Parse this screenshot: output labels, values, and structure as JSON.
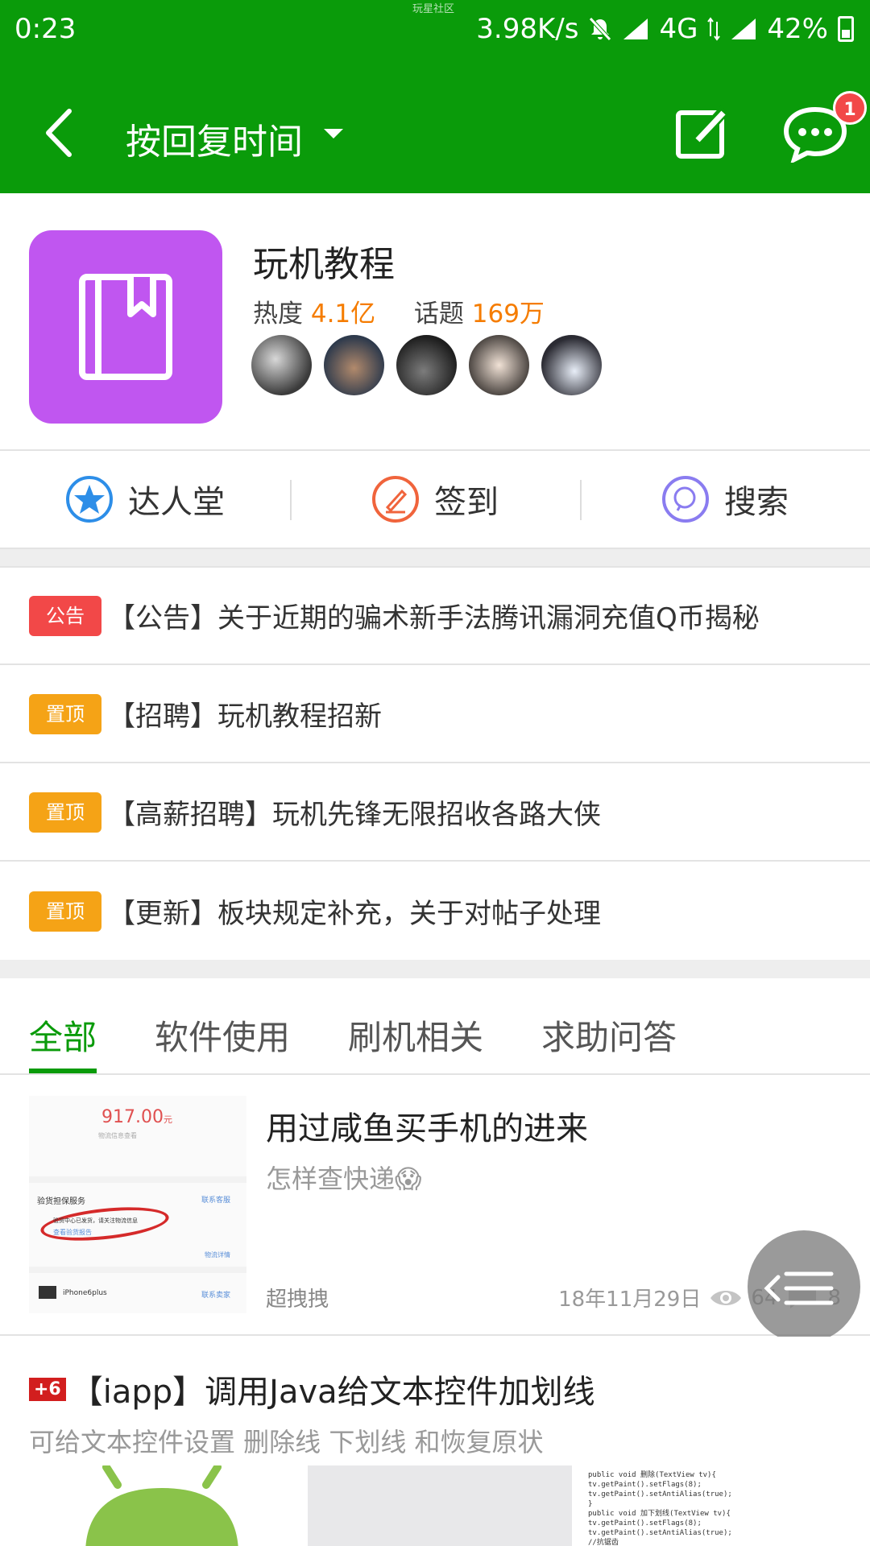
{
  "status_bar": {
    "time": "0:23",
    "watermark": "玩星社区",
    "speed": "3.98K/s",
    "network": "4G",
    "battery": "42%"
  },
  "app_bar": {
    "sort_label": "按回复时间",
    "message_badge": "1"
  },
  "forum": {
    "name": "玩机教程",
    "heat_label": "热度",
    "heat_value": "4.1亿",
    "topics_label": "话题",
    "topics_value": "169万",
    "logo_color": "#c056f0"
  },
  "quick_actions": {
    "experts": "达人堂",
    "checkin": "签到",
    "search": "搜索"
  },
  "notices": [
    {
      "tag": "公告",
      "text": "【公告】关于近期的骗术新手法腾讯漏洞充值Q币揭秘"
    },
    {
      "tag": "置顶",
      "text": "【招聘】玩机教程招新"
    },
    {
      "tag": "置顶",
      "text": "【高薪招聘】玩机先锋无限招收各路大侠"
    },
    {
      "tag": "置顶",
      "text": "【更新】板块规定补充，关于对帖子处理"
    }
  ],
  "tabs": [
    "全部",
    "软件使用",
    "刷机相关",
    "求助问答"
  ],
  "post1": {
    "title": "用过咸鱼买手机的进来",
    "subtitle": "怎样查快递😱",
    "author": "超拽拽",
    "date": "18年11月29日",
    "views": "64",
    "replies": "8",
    "thumb_price": "917.00",
    "thumb_price_unit": "元",
    "thumb_line1": "物流信息查看",
    "thumb_service": "验货担保服务",
    "thumb_contact": "联系客服",
    "thumb_notice": "验货中心已发货，请关注物流信息",
    "thumb_report": "查看验货报告",
    "thumb_logistics": "物流详情",
    "thumb_product": "iPhone6plus",
    "thumb_contact2": "联系卖家"
  },
  "post2": {
    "badge": "+6",
    "title": "【iapp】调用Java给文本控件加划线",
    "subtitle": "可给文本控件设置 删除线 下划线 和恢复原状",
    "code_lines": [
      "public void 删除(TextView tv){",
      "    tv.getPaint().setFlags(8);",
      "    tv.getPaint().setAntiAlias(true);",
      "}",
      "public void 加下划线(TextView tv){",
      "    tv.getPaint().setFlags(8);",
      "    tv.getPaint().setAntiAlias(true);",
      "    //抗锯齿"
    ]
  },
  "colors": {
    "primary": "#0a9b0a",
    "orange": "#f57c00",
    "tag_red": "#f24848",
    "tag_orange": "#f5a316"
  }
}
